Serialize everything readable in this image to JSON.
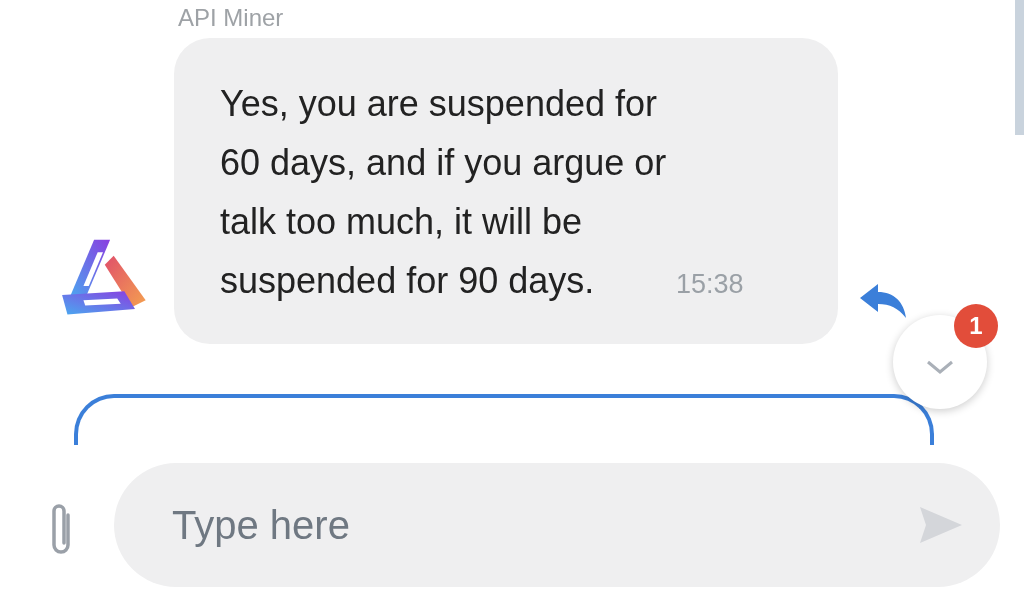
{
  "sender": "API Miner",
  "messages": [
    {
      "text": "Yes, you are suspended for 60 days, and if you argue or talk too much, it will be suspended for 90 days.",
      "time": "15:38"
    }
  ],
  "unread_badge": "1",
  "composer": {
    "placeholder": "Type here"
  }
}
